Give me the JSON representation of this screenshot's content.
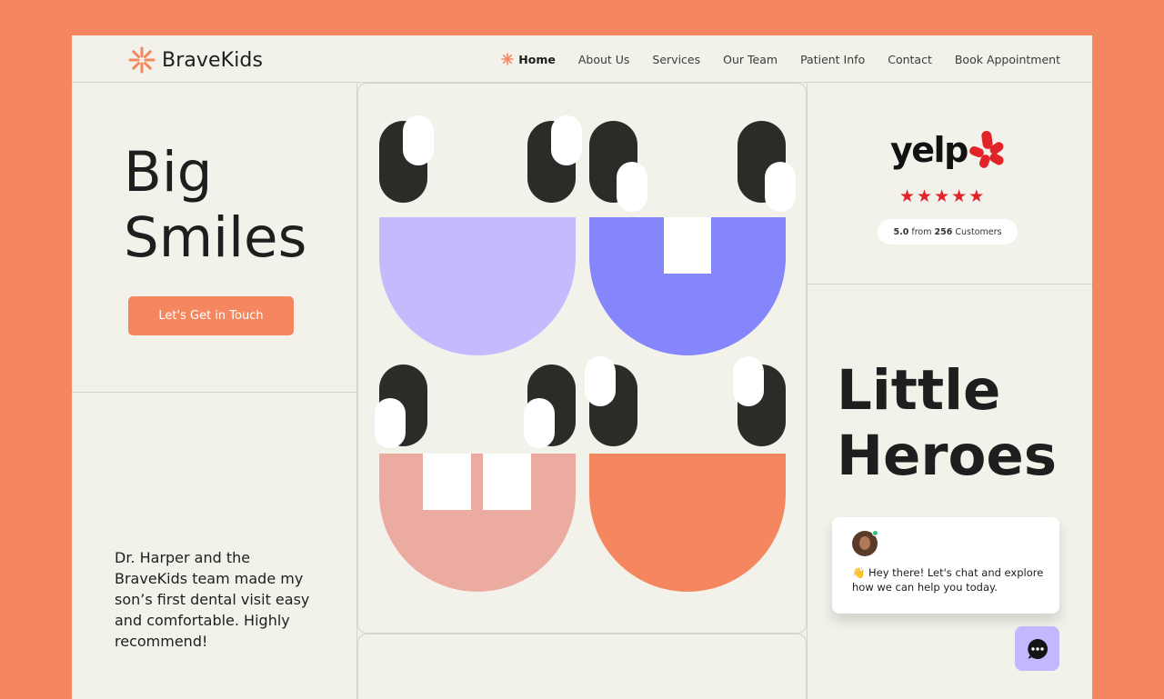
{
  "brand": {
    "name": "BraveKids",
    "accent": "#F4875F"
  },
  "nav": {
    "items": [
      {
        "label": "Home",
        "active": true
      },
      {
        "label": "About Us"
      },
      {
        "label": "Services"
      },
      {
        "label": "Our Team"
      },
      {
        "label": "Patient Info"
      },
      {
        "label": "Contact"
      },
      {
        "label": "Book Appointment"
      }
    ]
  },
  "hero": {
    "title_line1": "Big",
    "title_line2": "Smiles",
    "cta_label": "Let's Get in Touch"
  },
  "testimonial": {
    "quote": "Dr. Harper and the BraveKids team made my son’s first dental visit easy and comfortable. Highly recommend!"
  },
  "yelp": {
    "logo_text": "yelp",
    "rating": "5.0",
    "from_text": "from",
    "count": "256",
    "customers_text": "Customers",
    "stars": 5,
    "star_glyph": "★",
    "star_color": "#E0242A"
  },
  "secondary": {
    "title_line1": "Little",
    "title_line2": "Heroes"
  },
  "chat": {
    "message": "👋 Hey there! Let's chat and explore how we can help you today.",
    "button_icon": "chat-dots-icon"
  },
  "faces_colors": [
    "#C4BBFE",
    "#8585FC",
    "#EBABA0",
    "#F4875F"
  ]
}
